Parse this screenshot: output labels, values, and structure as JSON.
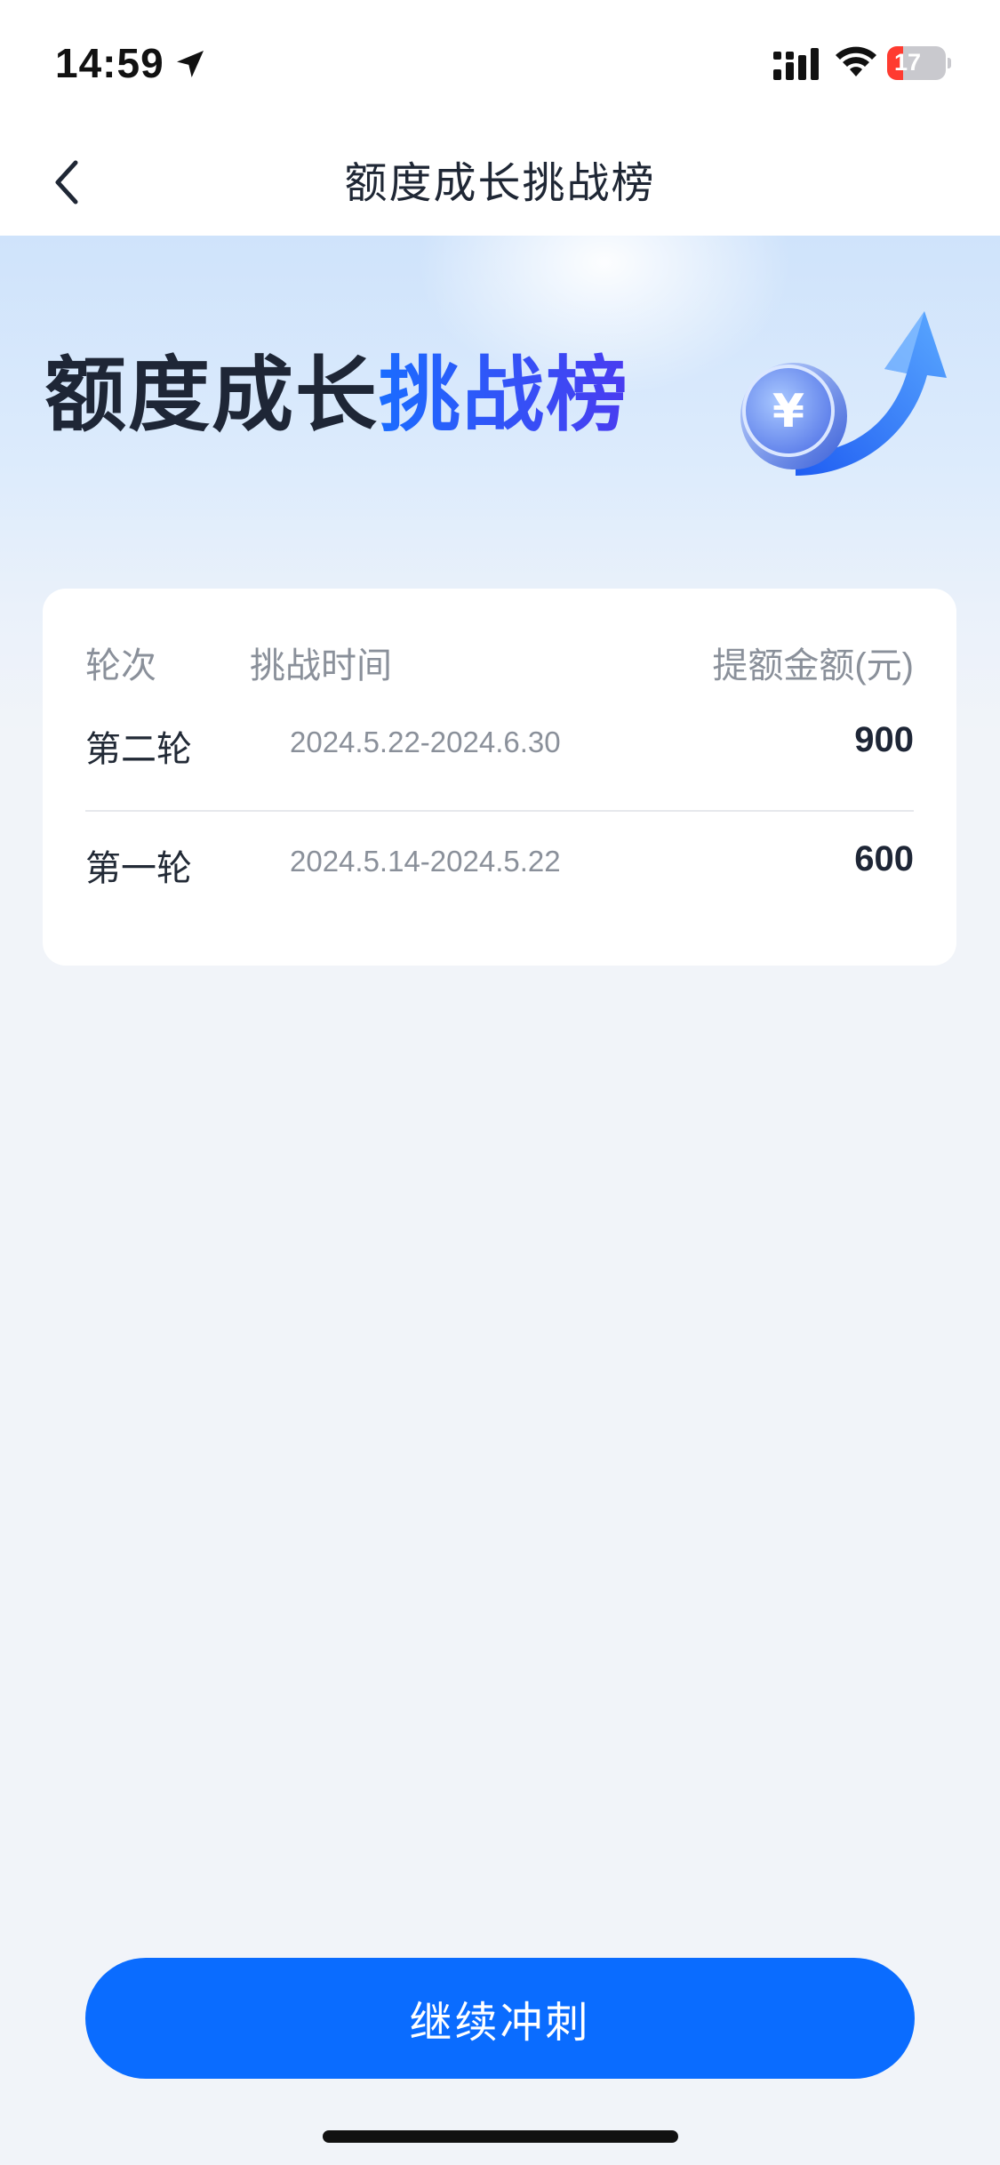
{
  "status_bar": {
    "time": "14:59",
    "battery_level": "17",
    "battery_fraction": 0.17,
    "icons": [
      "location-arrow-icon",
      "cellular-signal-icon",
      "wifi-icon",
      "battery-charging-icon"
    ]
  },
  "nav": {
    "back_icon": "chevron-left-icon",
    "title": "额度成长挑战榜"
  },
  "hero": {
    "title_dark": "额度成长",
    "title_highlight": "挑战榜",
    "art_icon": "coin-up-arrow-icon"
  },
  "table": {
    "headers": {
      "round": "轮次",
      "time": "挑战时间",
      "amount": "提额金额(元)"
    },
    "rows": [
      {
        "round": "第二轮",
        "time": "2024.5.22-2024.6.30",
        "amount": "900"
      },
      {
        "round": "第一轮",
        "time": "2024.5.14-2024.5.22",
        "amount": "600"
      }
    ]
  },
  "actions": {
    "continue_label": "继续冲刺"
  },
  "colors": {
    "accent": "#0a6cff",
    "title_dark": "#1e2636",
    "battery_low": "#ff3b30"
  }
}
